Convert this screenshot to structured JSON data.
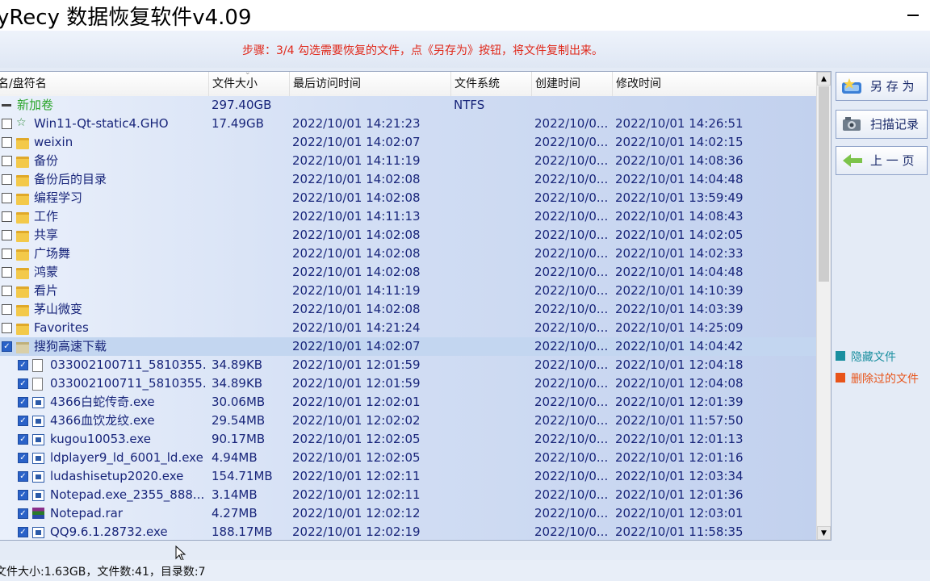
{
  "window": {
    "title": "yRecy 数据恢复软件v4.09"
  },
  "step": {
    "text": "步骤：3/4 勾选需要恢复的文件，点《另存为》按钮，将文件复制出来。"
  },
  "columns": [
    "名/盘符名",
    "文件大小",
    "最后访问时间",
    "文件系统",
    "创建时间",
    "修改时间"
  ],
  "rows": [
    {
      "name": "新加卷",
      "size": "297.40GB",
      "access": "",
      "fs": "NTFS",
      "created": "",
      "modified": "",
      "type": "volume",
      "checked": false
    },
    {
      "name": "Win11-Qt-static4.GHO",
      "size": "17.49GB",
      "access": "2022/10/01 14:21:23",
      "fs": "",
      "created": "2022/10/0...",
      "modified": "2022/10/01 14:26:51",
      "type": "ghost",
      "checked": false
    },
    {
      "name": "weixin",
      "size": "",
      "access": "2022/10/01 14:02:07",
      "fs": "",
      "created": "2022/10/0...",
      "modified": "2022/10/01 14:02:15",
      "type": "folder",
      "checked": false
    },
    {
      "name": "备份",
      "size": "",
      "access": "2022/10/01 14:11:19",
      "fs": "",
      "created": "2022/10/0...",
      "modified": "2022/10/01 14:08:36",
      "type": "folder",
      "checked": false
    },
    {
      "name": "备份后的目录",
      "size": "",
      "access": "2022/10/01 14:02:08",
      "fs": "",
      "created": "2022/10/0...",
      "modified": "2022/10/01 14:04:48",
      "type": "folder",
      "checked": false
    },
    {
      "name": "编程学习",
      "size": "",
      "access": "2022/10/01 14:02:08",
      "fs": "",
      "created": "2022/10/0...",
      "modified": "2022/10/01 13:59:49",
      "type": "folder",
      "checked": false
    },
    {
      "name": "工作",
      "size": "",
      "access": "2022/10/01 14:11:13",
      "fs": "",
      "created": "2022/10/0...",
      "modified": "2022/10/01 14:08:43",
      "type": "folder",
      "checked": false
    },
    {
      "name": "共享",
      "size": "",
      "access": "2022/10/01 14:02:08",
      "fs": "",
      "created": "2022/10/0...",
      "modified": "2022/10/01 14:02:05",
      "type": "folder",
      "checked": false
    },
    {
      "name": "广场舞",
      "size": "",
      "access": "2022/10/01 14:02:08",
      "fs": "",
      "created": "2022/10/0...",
      "modified": "2022/10/01 14:02:33",
      "type": "folder",
      "checked": false
    },
    {
      "name": "鸿蒙",
      "size": "",
      "access": "2022/10/01 14:02:08",
      "fs": "",
      "created": "2022/10/0...",
      "modified": "2022/10/01 14:04:48",
      "type": "folder",
      "checked": false
    },
    {
      "name": "看片",
      "size": "",
      "access": "2022/10/01 14:11:19",
      "fs": "",
      "created": "2022/10/0...",
      "modified": "2022/10/01 14:10:39",
      "type": "folder",
      "checked": false
    },
    {
      "name": "茅山微变",
      "size": "",
      "access": "2022/10/01 14:02:08",
      "fs": "",
      "created": "2022/10/0...",
      "modified": "2022/10/01 14:03:39",
      "type": "folder",
      "checked": false
    },
    {
      "name": "Favorites",
      "size": "",
      "access": "2022/10/01 14:21:24",
      "fs": "",
      "created": "2022/10/0...",
      "modified": "2022/10/01 14:25:09",
      "type": "folder",
      "checked": false
    },
    {
      "name": "搜狗高速下载",
      "size": "",
      "access": "2022/10/01 14:02:07",
      "fs": "",
      "created": "2022/10/0...",
      "modified": "2022/10/01 14:04:42",
      "type": "folder-open",
      "checked": true,
      "selected": true
    },
    {
      "name": "033002100711_5810355...",
      "size": "34.89KB",
      "access": "2022/10/01 12:01:59",
      "fs": "",
      "created": "2022/10/0...",
      "modified": "2022/10/01 12:04:18",
      "type": "doc",
      "checked": true,
      "child": true
    },
    {
      "name": "033002100711_5810355...",
      "size": "34.89KB",
      "access": "2022/10/01 12:01:59",
      "fs": "",
      "created": "2022/10/0...",
      "modified": "2022/10/01 12:04:08",
      "type": "doc",
      "checked": true,
      "child": true
    },
    {
      "name": "4366白蛇传奇.exe",
      "size": "30.06MB",
      "access": "2022/10/01 12:02:01",
      "fs": "",
      "created": "2022/10/0...",
      "modified": "2022/10/01 12:01:39",
      "type": "exe",
      "checked": true,
      "child": true
    },
    {
      "name": "4366血饮龙纹.exe",
      "size": "29.54MB",
      "access": "2022/10/01 12:02:02",
      "fs": "",
      "created": "2022/10/0...",
      "modified": "2022/10/01 11:57:50",
      "type": "exe",
      "checked": true,
      "child": true
    },
    {
      "name": "kugou10053.exe",
      "size": "90.17MB",
      "access": "2022/10/01 12:02:05",
      "fs": "",
      "created": "2022/10/0...",
      "modified": "2022/10/01 12:01:13",
      "type": "exe",
      "checked": true,
      "child": true
    },
    {
      "name": "ldplayer9_ld_6001_ld.exe",
      "size": "4.94MB",
      "access": "2022/10/01 12:02:05",
      "fs": "",
      "created": "2022/10/0...",
      "modified": "2022/10/01 12:01:16",
      "type": "exe",
      "checked": true,
      "child": true
    },
    {
      "name": "ludashisetup2020.exe",
      "size": "154.71MB",
      "access": "2022/10/01 12:02:11",
      "fs": "",
      "created": "2022/10/0...",
      "modified": "2022/10/01 12:03:34",
      "type": "exe",
      "checked": true,
      "child": true
    },
    {
      "name": "Notepad.exe_2355_888...",
      "size": "3.14MB",
      "access": "2022/10/01 12:02:11",
      "fs": "",
      "created": "2022/10/0...",
      "modified": "2022/10/01 12:01:36",
      "type": "exe",
      "checked": true,
      "child": true
    },
    {
      "name": "Notepad.rar",
      "size": "4.27MB",
      "access": "2022/10/01 12:02:12",
      "fs": "",
      "created": "2022/10/0...",
      "modified": "2022/10/01 12:03:01",
      "type": "rar",
      "checked": true,
      "child": true
    },
    {
      "name": "QQ9.6.1.28732.exe",
      "size": "188.17MB",
      "access": "2022/10/01 12:02:19",
      "fs": "",
      "created": "2022/10/0...",
      "modified": "2022/10/01 11:58:35",
      "type": "exe",
      "checked": true,
      "child": true
    }
  ],
  "buttons": {
    "save_as": "另 存 为",
    "scan_log": "扫描记录",
    "prev_page": "上 一 页"
  },
  "legend": [
    {
      "label": "隐藏文件",
      "color": "#1a8fa0"
    },
    {
      "label": "删除过的文件",
      "color": "#e8541a"
    }
  ],
  "status": {
    "text": "文件大小:1.63GB，文件数:41，目录数:7"
  }
}
